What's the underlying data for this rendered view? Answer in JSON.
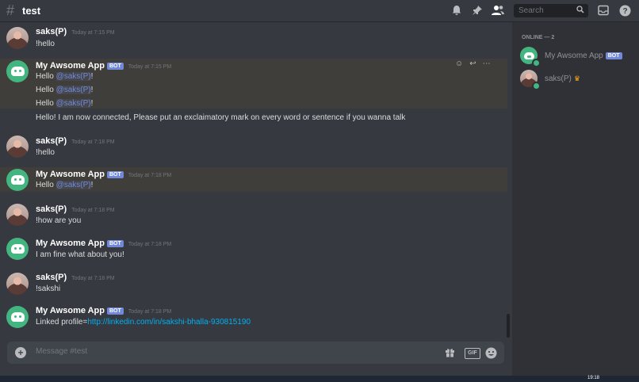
{
  "header": {
    "channel": "test",
    "search_placeholder": "Search",
    "icons": [
      "bell-icon",
      "pin-icon",
      "members-icon",
      "search-icon",
      "inbox-icon",
      "help-icon"
    ]
  },
  "messages": [
    {
      "author": "saks(P)",
      "time": "Today at 7:15 PM",
      "bot": false,
      "lines": [
        "!hello"
      ]
    },
    {
      "author": "My Awsome App",
      "bot_tag": "BOT",
      "time": "Today at 7:15 PM",
      "bot": true,
      "lines": [
        {
          "prefix": "Hello ",
          "mention": "@saks(P)",
          "suffix": "!"
        },
        {
          "prefix": "Hello ",
          "mention": "@saks(P)",
          "suffix": "!"
        },
        {
          "prefix": "Hello ",
          "mention": "@saks(P)",
          "suffix": "!"
        },
        {
          "prefix": "Hello! I am now connected, Please put an exclaimatory mark on every word or sentence if you wanna talk"
        }
      ]
    },
    {
      "author": "saks(P)",
      "time": "Today at 7:18 PM",
      "bot": false,
      "lines": [
        "!hello"
      ]
    },
    {
      "author": "My Awsome App",
      "bot_tag": "BOT",
      "time": "Today at 7:18 PM",
      "bot": true,
      "lines": [
        {
          "prefix": "Hello ",
          "mention": "@saks(P)",
          "suffix": "!"
        }
      ]
    },
    {
      "author": "saks(P)",
      "time": "Today at 7:18 PM",
      "bot": false,
      "lines": [
        "!how are you"
      ]
    },
    {
      "author": "My Awsome App",
      "bot_tag": "BOT",
      "time": "Today at 7:18 PM",
      "bot": true,
      "lines": [
        "I am fine what about you!"
      ]
    },
    {
      "author": "saks(P)",
      "time": "Today at 7:18 PM",
      "bot": false,
      "lines": [
        "!sakshi"
      ]
    },
    {
      "author": "My Awsome App",
      "bot_tag": "BOT",
      "time": "Today at 7:18 PM",
      "bot": true,
      "lines": [
        {
          "prefix": "Linked profile=",
          "link": "http://linkedin.com/in/sakshi-bhalla-930815190"
        }
      ]
    }
  ],
  "composer": {
    "placeholder": "Message #test",
    "icons": [
      "gift-icon",
      "gif-icon",
      "emoji-icon"
    ]
  },
  "members": {
    "heading": "ONLINE — 2",
    "list": [
      {
        "name": "My Awsome App",
        "tag": "BOT"
      },
      {
        "name": "saks(P)",
        "crown": "♛"
      }
    ]
  },
  "taskbar": {
    "time": "19:18"
  },
  "colors": {
    "bot_tag": "#7289da",
    "mention": "#7289da",
    "online": "#43b581",
    "link": "#00b0f4"
  }
}
